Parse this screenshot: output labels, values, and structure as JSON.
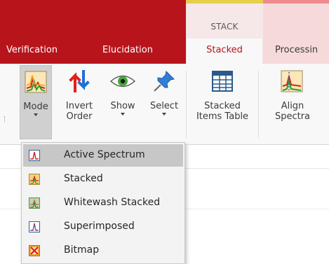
{
  "tabs": {
    "verification": "Verification",
    "elucidation": "Elucidation",
    "stacked": "Stacked",
    "processing": "Processin",
    "context_group": "STACK"
  },
  "ribbon": {
    "mode": "Mode",
    "invert_line1": "Invert",
    "invert_line2": "Order",
    "show": "Show",
    "select": "Select",
    "stacked_tbl_line1": "Stacked",
    "stacked_tbl_line2": "Items Table",
    "align_line1": "Align",
    "align_line2": "Spectra"
  },
  "menu": {
    "items": [
      {
        "label": "Active Spectrum",
        "icon": "active-spectrum-icon",
        "selected": true
      },
      {
        "label": "Stacked",
        "icon": "stacked-icon",
        "selected": false
      },
      {
        "label": "Whitewash Stacked",
        "icon": "whitewash-stacked-icon",
        "selected": false
      },
      {
        "label": "Superimposed",
        "icon": "superimposed-icon",
        "selected": false
      },
      {
        "label": "Bitmap",
        "icon": "bitmap-icon",
        "selected": false
      }
    ]
  },
  "colors": {
    "tab_red": "#b8141c",
    "menu_bg": "#f3f3f3",
    "menu_selected": "#c7c7c7",
    "context_accent": "#e6cf4d"
  }
}
